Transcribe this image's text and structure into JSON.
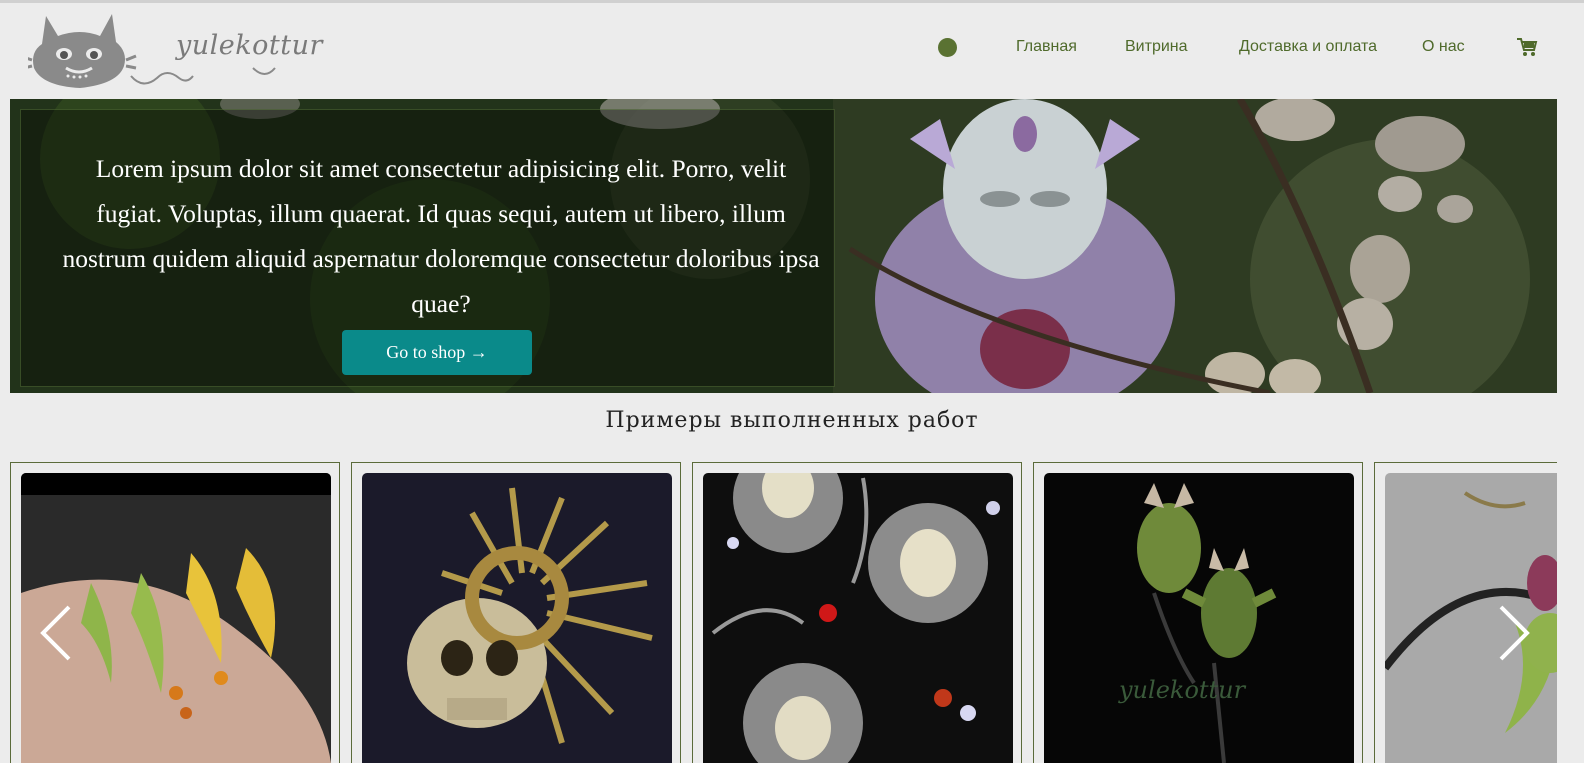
{
  "brand": {
    "name": "yulekottur"
  },
  "nav": {
    "items": [
      {
        "label": "Главная"
      },
      {
        "label": "Витрина"
      },
      {
        "label": "Доставка и оплата"
      },
      {
        "label": "О нас"
      }
    ],
    "accent_color": "#4f6a2b"
  },
  "hero": {
    "text": "Lorem ipsum dolor sit amet consectetur adipisicing elit. Porro, velit fugiat. Voluptas, illum quaerat. Id quas sequi, autem ut libero, illum nostrum quidem aliquid aspernatur doloremque consectetur doloribus ipsa quae?",
    "button_label": "Go to shop →",
    "button_color": "#0a8a8a"
  },
  "works": {
    "title": "Примеры выполненных работ",
    "watermark": "yulekottur"
  },
  "icons": {
    "logo": "cat-face-icon",
    "status": "green-dot-icon",
    "cart": "shopping-cart-icon",
    "prev": "chevron-left-icon",
    "next": "chevron-right-icon"
  }
}
